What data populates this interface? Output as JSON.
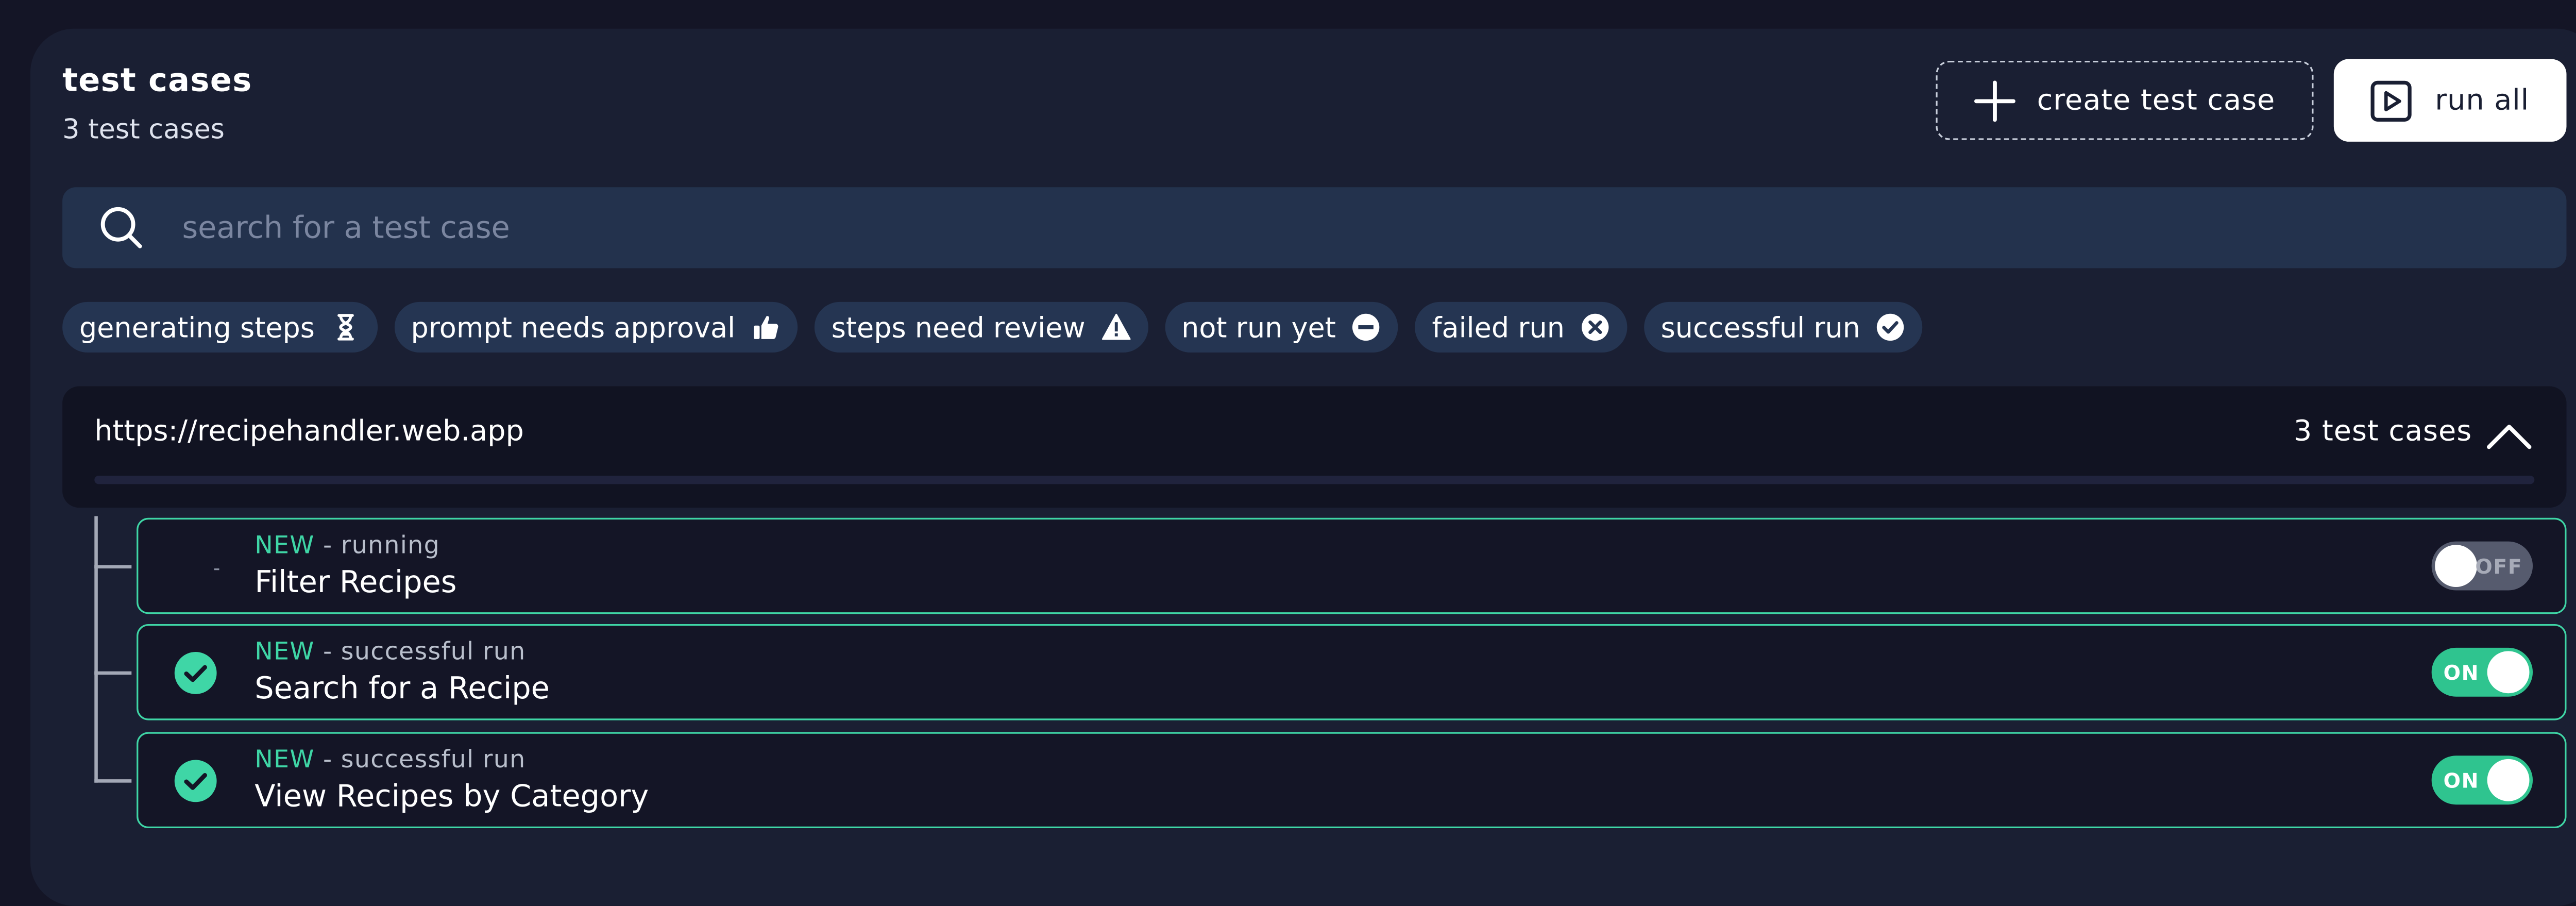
{
  "header": {
    "title": "test cases",
    "subtitle": "3 test cases",
    "create_label": "create test case",
    "run_all_label": "run all"
  },
  "search": {
    "placeholder": "search for a test case"
  },
  "filters": [
    {
      "label": "generating steps",
      "icon": "hourglass-icon"
    },
    {
      "label": "prompt needs approval",
      "icon": "thumbs-up-icon"
    },
    {
      "label": "steps need review",
      "icon": "warning-icon"
    },
    {
      "label": "not run yet",
      "icon": "minus-circle-icon"
    },
    {
      "label": "failed run",
      "icon": "x-circle-icon"
    },
    {
      "label": "successful run",
      "icon": "check-circle-icon"
    }
  ],
  "group": {
    "url": "https://recipehandler.web.app",
    "count_label": "3 test cases"
  },
  "test_cases": [
    {
      "badge": "NEW",
      "status": " - running",
      "name": "Filter Recipes",
      "toggle": "OFF",
      "status_icon": "spinner-icon"
    },
    {
      "badge": "NEW",
      "status": " - successful run",
      "name": "Search for a Recipe",
      "toggle": "ON",
      "status_icon": "check-circle-icon"
    },
    {
      "badge": "NEW",
      "status": " - successful run",
      "name": "View Recipes by Category",
      "toggle": "ON",
      "status_icon": "check-circle-icon"
    }
  ],
  "colors": {
    "background": "#141526",
    "panel": "#1a1f33",
    "accent_green": "#3fd6a6",
    "toggle_on": "#2fc48f",
    "toggle_off": "#565b6e",
    "chip": "#253552"
  }
}
